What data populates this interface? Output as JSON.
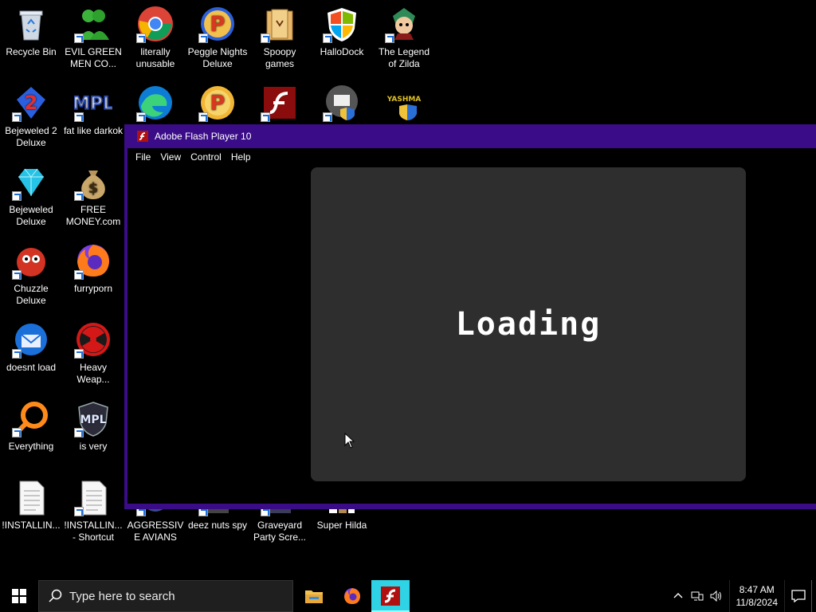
{
  "desktop": {
    "icons": [
      {
        "label": "Recycle Bin",
        "icon": "recycle-bin-icon"
      },
      {
        "label": "EVIL GREEN MEN CO...",
        "icon": "green-men-icon"
      },
      {
        "label": "literally unusable",
        "icon": "chrome-icon"
      },
      {
        "label": "Peggle Nights Deluxe",
        "icon": "peggle-icon"
      },
      {
        "label": "Spoopy games",
        "icon": "folder-icon"
      },
      {
        "label": "HalloDock",
        "icon": "windows-shield-icon"
      },
      {
        "label": "The Legend of Zilda",
        "icon": "zilda-icon"
      },
      {
        "label": "Bejeweled 2 Deluxe",
        "icon": "bejeweled2-icon"
      },
      {
        "label": "fat like darkok",
        "icon": "mpl-icon"
      },
      {
        "label": "",
        "icon": "edge-icon"
      },
      {
        "label": "",
        "icon": "peggle-icon"
      },
      {
        "label": "",
        "icon": "flash-icon"
      },
      {
        "label": "",
        "icon": "program-shield-icon"
      },
      {
        "label": "",
        "icon": "yashma-icon"
      },
      {
        "label": "Bejeweled Deluxe",
        "icon": "diamond-icon"
      },
      {
        "label": "FREE MONEY.com",
        "icon": "money-bag-icon"
      },
      {
        "label": "Chuzzle Deluxe",
        "icon": "chuzzle-icon"
      },
      {
        "label": "furryporn",
        "icon": "firefox-icon"
      },
      {
        "label": "doesnt load",
        "icon": "thunderbird-icon"
      },
      {
        "label": "Heavy Weap...",
        "icon": "radiation-icon"
      },
      {
        "label": "Everything",
        "icon": "search-ring-icon"
      },
      {
        "label": "is very",
        "icon": "mpl-shield-icon"
      },
      {
        "label": "!INSTALLIN...",
        "icon": "text-file-icon"
      },
      {
        "label": "!INSTALLIN... - Shortcut",
        "icon": "text-file-icon"
      },
      {
        "label": "AGGRESSIVE AVIANS",
        "icon": "avians-icon"
      },
      {
        "label": "deez nuts spy",
        "icon": "spy-icon"
      },
      {
        "label": "Graveyard Party Scre...",
        "icon": "graveyard-icon"
      },
      {
        "label": "Super Hilda",
        "icon": "hilda-icon"
      }
    ]
  },
  "flash_window": {
    "title": "Adobe Flash Player 10",
    "menu": [
      "File",
      "View",
      "Control",
      "Help"
    ],
    "stage_text": "Loading"
  },
  "taskbar": {
    "search_placeholder": "Type here to search",
    "apps": [
      {
        "icon": "file-explorer-icon",
        "active": false
      },
      {
        "icon": "firefox-icon",
        "active": false
      },
      {
        "icon": "flash-icon",
        "active": true
      }
    ],
    "time": "8:47 AM",
    "date": "11/8/2024"
  },
  "colors": {
    "window_frame": "#3a0c88",
    "stage": "#2e2e2e",
    "taskbar_active": "#2ed3e6"
  }
}
